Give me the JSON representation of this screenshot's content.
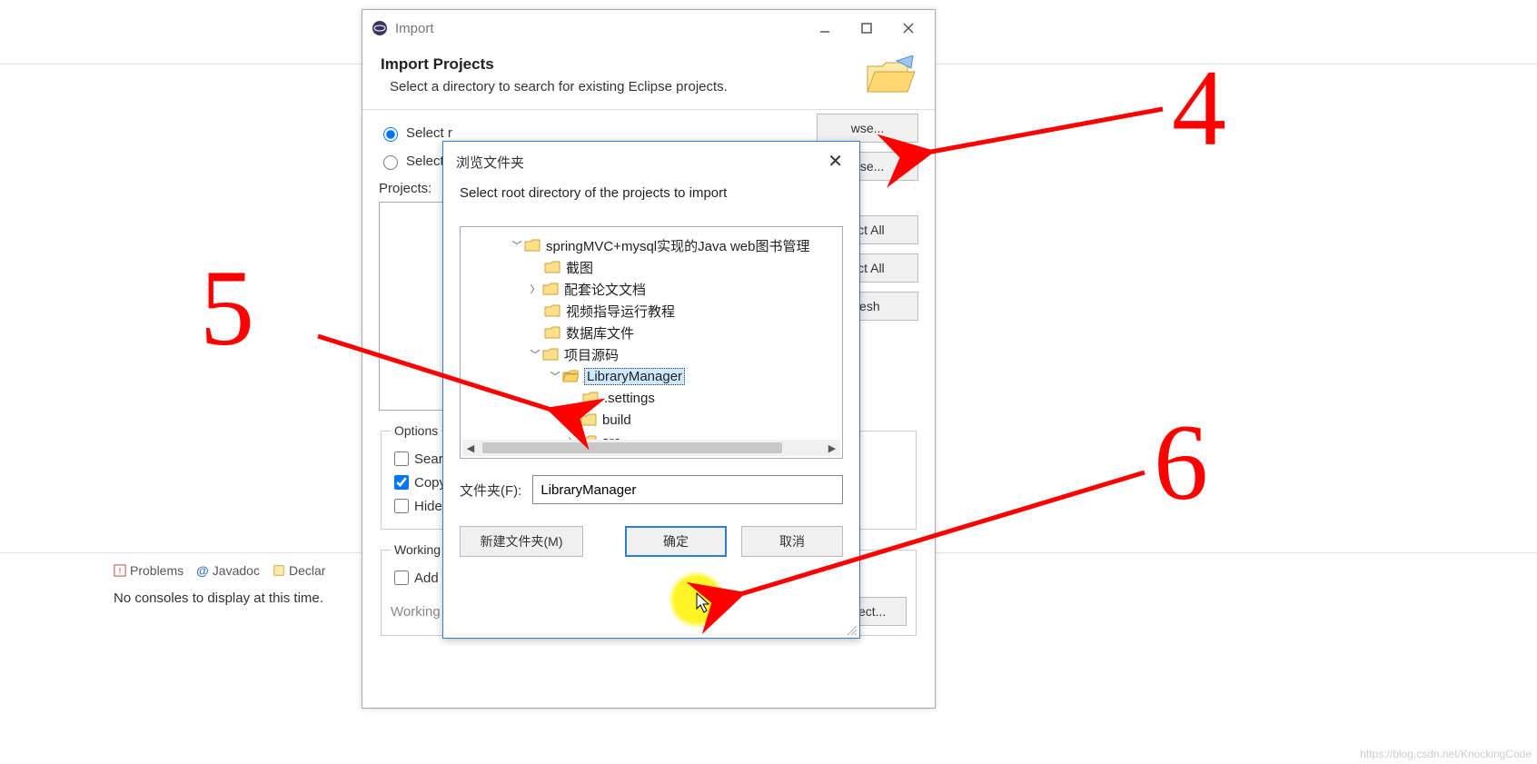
{
  "eclipse": {
    "tabs": {
      "problems": "Problems",
      "javadoc": "Javadoc",
      "declar": "Declar"
    },
    "no_consoles": "No consoles to display at this time."
  },
  "import": {
    "title": "Import",
    "heading": "Import Projects",
    "subheading": "Select a directory to search for existing Eclipse projects.",
    "radio_root": "Select r",
    "radio_archive": "Select a",
    "projects_label": "Projects:",
    "browse1": "wse...",
    "browse2": "wse...",
    "select_all": "ect All",
    "deselect_all": "ect All",
    "refresh": "resh",
    "options_legend": "Options",
    "chk_search": "Searc",
    "chk_copy": "Copy",
    "chk_hide": "Hide p",
    "ws_legend": "Working",
    "chk_add": "Add",
    "ws_label": "Working sets:",
    "select_btn": "Select..."
  },
  "browse": {
    "title": "浏览文件夹",
    "sub": "Select root directory of the projects to import",
    "folder_label": "文件夹(F):",
    "folder_value": "LibraryManager",
    "new_folder_btn": "新建文件夹(M)",
    "ok_btn": "确定",
    "cancel_btn": "取消",
    "tree": {
      "root": "springMVC+mysql实现的Java web图书管理",
      "n1": "截图",
      "n2": "配套论文文档",
      "n3": "视频指导运行教程",
      "n4": "数据库文件",
      "n5": "项目源码",
      "lib": "LibraryManager",
      "settings": ".settings",
      "build": "build",
      "src": "src"
    }
  },
  "annotations": {
    "a4": "4",
    "a5": "5",
    "a6": "6"
  },
  "watermark": "https://blog.csdn.net/KnockingCode"
}
